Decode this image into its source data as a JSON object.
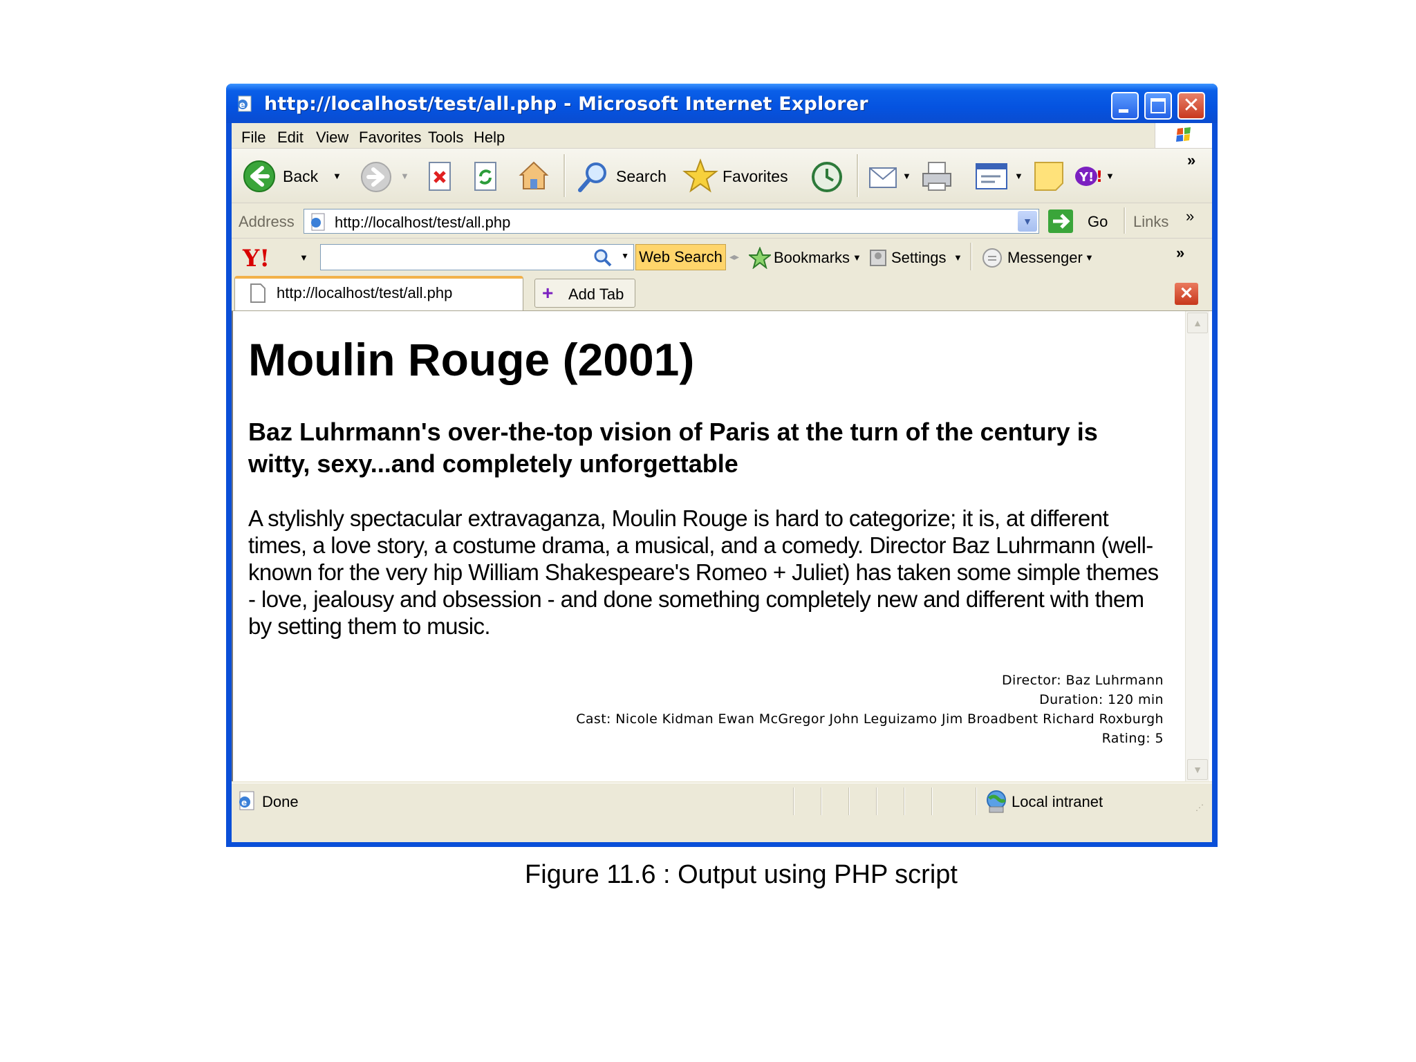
{
  "window": {
    "title": "http://localhost/test/all.php - Microsoft Internet Explorer"
  },
  "menubar": {
    "items": [
      "File",
      "Edit",
      "View",
      "Favorites",
      "Tools",
      "Help"
    ]
  },
  "toolbar": {
    "back_label": "Back",
    "search_label": "Search",
    "favorites_label": "Favorites"
  },
  "addressbar": {
    "label": "Address",
    "url": "http://localhost/test/all.php",
    "go_label": "Go",
    "links_label": "Links"
  },
  "yahoo_toolbar": {
    "search_button_label": "Web Search",
    "bookmarks_label": "Bookmarks",
    "settings_label": "Settings",
    "messenger_label": "Messenger"
  },
  "tabs": {
    "active_tab_label": "http://localhost/test/all.php",
    "add_tab_label": "Add Tab"
  },
  "page": {
    "title": "Moulin Rouge (2001)",
    "subtitle": "Baz Luhrmann's over-the-top vision of Paris at the turn of the century is witty, sexy...and completely unforgettable",
    "body": "A stylishly spectacular extravaganza, Moulin Rouge is hard to categorize; it is, at different times, a love story, a costume drama, a musical, and a comedy. Director Baz Luhrmann (well-known for the very hip William Shakespeare's Romeo + Juliet) has taken some simple themes - love, jealousy and obsession - and done something completely new and different with them by setting them to music.",
    "director": "Director: Baz Luhrmann",
    "duration": "Duration: 120 min",
    "cast": "Cast: Nicole Kidman Ewan McGregor John Leguizamo Jim Broadbent Richard Roxburgh",
    "rating": "Rating: 5"
  },
  "statusbar": {
    "status": "Done",
    "zone": "Local intranet"
  },
  "caption": "Figure 11.6 : Output using PHP script",
  "colors": {
    "titlebar_blue": "#0a5fe8",
    "chrome_beige": "#ece9d8",
    "close_red": "#c8381e",
    "yahoo_red": "#d80000",
    "yahoo_purple": "#7b20c0"
  }
}
